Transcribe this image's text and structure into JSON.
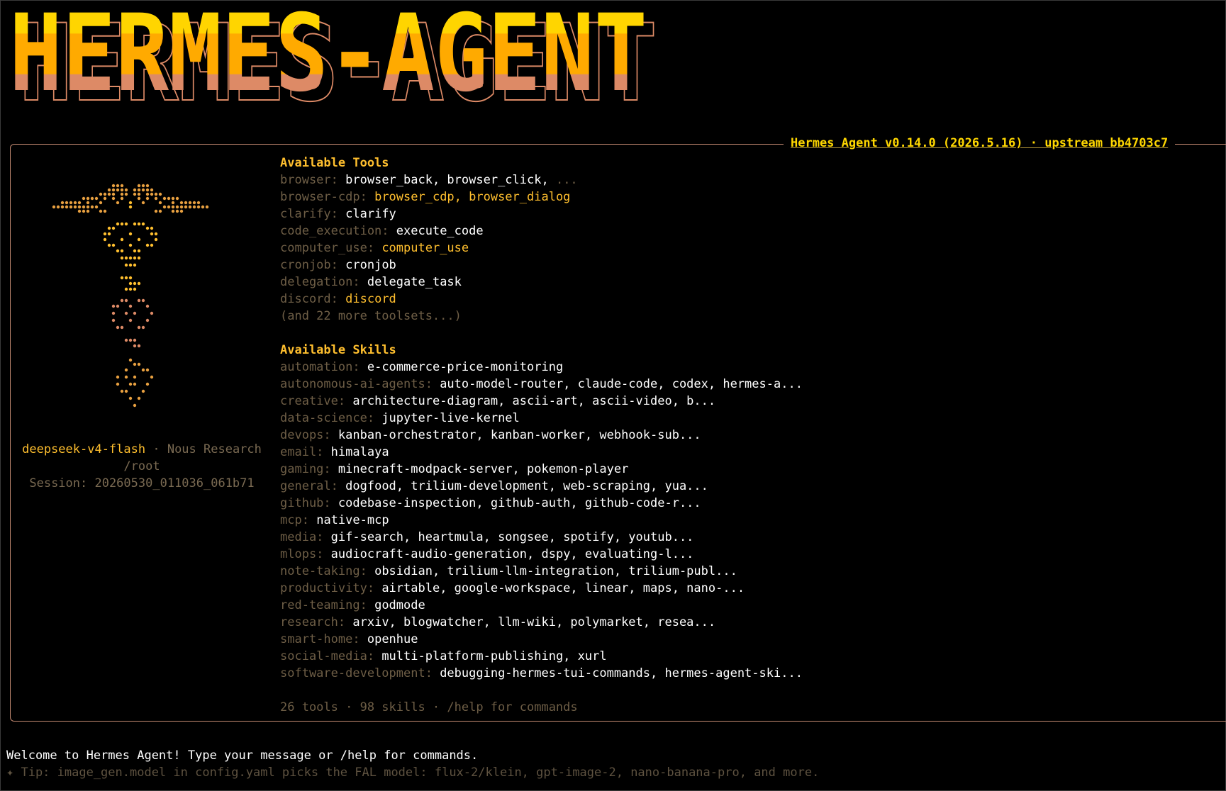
{
  "banner": {
    "title": "HERMES-AGENT"
  },
  "header": {
    "version_line": "Hermes Agent v0.14.0 (2026.5.16) · upstream bb4703c7"
  },
  "left": {
    "model": "deepseek-v4-flash",
    "separator": " · ",
    "provider": "Nous Research",
    "cwd": "/root",
    "session": "Session: 20260530_011036_061b71"
  },
  "tools": {
    "heading": "Available Tools",
    "items": [
      {
        "cat": "browser:",
        "val": "browser_back, browser_click,",
        "more": " ..."
      },
      {
        "cat": "browser-cdp:",
        "val": "browser_cdp, browser_dialog"
      },
      {
        "cat": "clarify:",
        "val": "clarify"
      },
      {
        "cat": "code_execution:",
        "val": "execute_code"
      },
      {
        "cat": "computer_use:",
        "val": "computer_use"
      },
      {
        "cat": "cronjob:",
        "val": "cronjob"
      },
      {
        "cat": "delegation:",
        "val": "delegate_task"
      },
      {
        "cat": "discord:",
        "val": "discord"
      }
    ],
    "more": "(and 22 more toolsets...)"
  },
  "skills": {
    "heading": "Available Skills",
    "items": [
      {
        "cat": "automation:",
        "val": "e-commerce-price-monitoring"
      },
      {
        "cat": "autonomous-ai-agents:",
        "val": "auto-model-router, claude-code, codex, hermes-a..."
      },
      {
        "cat": "creative:",
        "val": "architecture-diagram, ascii-art, ascii-video, b..."
      },
      {
        "cat": "data-science:",
        "val": "jupyter-live-kernel"
      },
      {
        "cat": "devops:",
        "val": "kanban-orchestrator, kanban-worker, webhook-sub..."
      },
      {
        "cat": "email:",
        "val": "himalaya"
      },
      {
        "cat": "gaming:",
        "val": "minecraft-modpack-server, pokemon-player"
      },
      {
        "cat": "general:",
        "val": "dogfood, trilium-development, web-scraping, yua..."
      },
      {
        "cat": "github:",
        "val": "codebase-inspection, github-auth, github-code-r..."
      },
      {
        "cat": "mcp:",
        "val": "native-mcp"
      },
      {
        "cat": "media:",
        "val": "gif-search, heartmula, songsee, spotify, youtub..."
      },
      {
        "cat": "mlops:",
        "val": "audiocraft-audio-generation, dspy, evaluating-l..."
      },
      {
        "cat": "note-taking:",
        "val": "obsidian, trilium-llm-integration, trilium-publ..."
      },
      {
        "cat": "productivity:",
        "val": "airtable, google-workspace, linear, maps, nano-..."
      },
      {
        "cat": "red-teaming:",
        "val": "godmode"
      },
      {
        "cat": "research:",
        "val": "arxiv, blogwatcher, llm-wiki, polymarket, resea..."
      },
      {
        "cat": "smart-home:",
        "val": "openhue"
      },
      {
        "cat": "social-media:",
        "val": "multi-platform-publishing, xurl"
      },
      {
        "cat": "software-development:",
        "val": "debugging-hermes-tui-commands, hermes-agent-ski..."
      }
    ]
  },
  "stats": "26 tools · 98 skills · /help for commands",
  "welcome": "Welcome to Hermes Agent! Type your message or /help for commands.",
  "tip": "✦ Tip: image_gen.model in config.yaml picks the FAL model: flux-2/klein, gpt-image-2, nano-banana-pro, and more.",
  "colors": {
    "accent": "#ffbf2e",
    "title_gold": "#ffd700",
    "banner_gold": "#ffc400",
    "banner_orange": "#ffa500",
    "banner_salmon": "#dd8a66",
    "border": "#c58a72",
    "dim": "#6e5e46"
  }
}
